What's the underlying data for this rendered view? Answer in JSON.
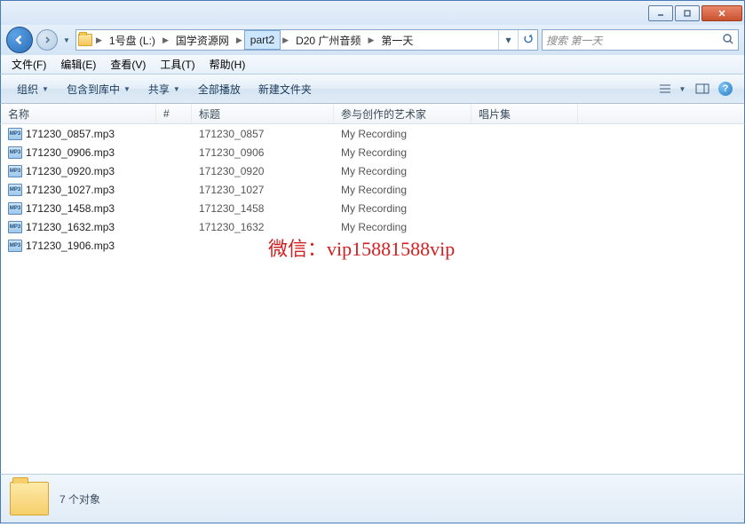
{
  "breadcrumb": {
    "items": [
      {
        "label": "1号盘 (L:)"
      },
      {
        "label": "国学资源网"
      },
      {
        "label": "part2"
      },
      {
        "label": "D20 广州音频"
      },
      {
        "label": "第一天"
      }
    ],
    "selected_index": 2
  },
  "search": {
    "placeholder": "搜索 第一天"
  },
  "menubar": [
    {
      "label": "文件(F)"
    },
    {
      "label": "编辑(E)"
    },
    {
      "label": "查看(V)"
    },
    {
      "label": "工具(T)"
    },
    {
      "label": "帮助(H)"
    }
  ],
  "toolbar": {
    "organize": "组织",
    "include": "包含到库中",
    "share": "共享",
    "playall": "全部播放",
    "newfolder": "新建文件夹"
  },
  "columns": {
    "name": "名称",
    "num": "#",
    "title": "标题",
    "artist": "参与创作的艺术家",
    "album": "唱片集"
  },
  "files": [
    {
      "name": "171230_0857.mp3",
      "title": "171230_0857",
      "artist": "My Recording"
    },
    {
      "name": "171230_0906.mp3",
      "title": "171230_0906",
      "artist": "My Recording"
    },
    {
      "name": "171230_0920.mp3",
      "title": "171230_0920",
      "artist": "My Recording"
    },
    {
      "name": "171230_1027.mp3",
      "title": "171230_1027",
      "artist": "My Recording"
    },
    {
      "name": "171230_1458.mp3",
      "title": "171230_1458",
      "artist": "My Recording"
    },
    {
      "name": "171230_1632.mp3",
      "title": "171230_1632",
      "artist": "My Recording"
    },
    {
      "name": "171230_1906.mp3",
      "title": "",
      "artist": ""
    }
  ],
  "watermark": "微信：vip15881588vip",
  "status": {
    "count": "7 个对象"
  },
  "icons": {
    "mp3": "MP3"
  }
}
